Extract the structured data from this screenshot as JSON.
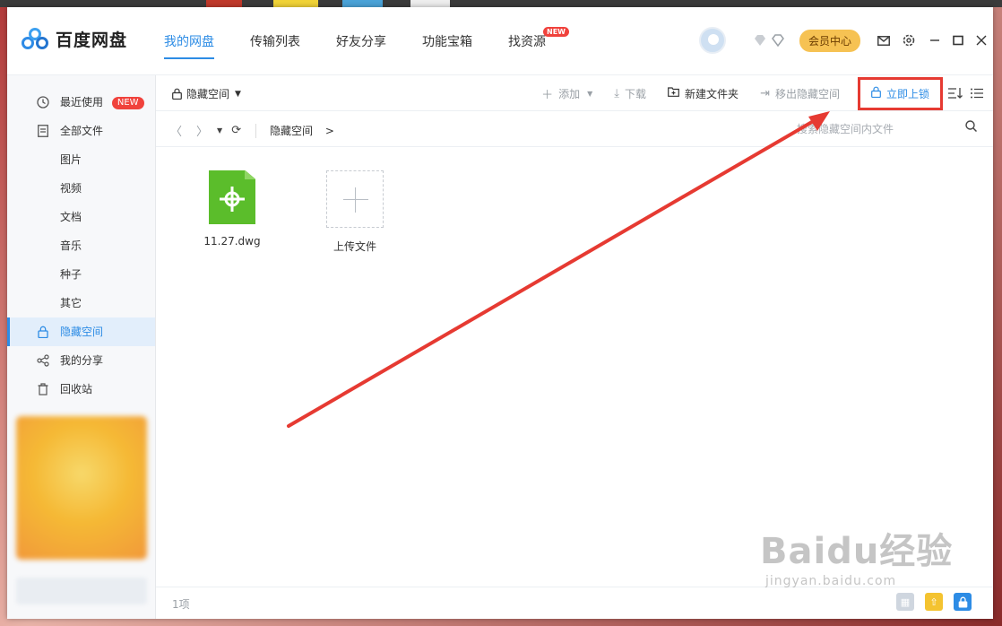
{
  "app": {
    "name": "百度网盘"
  },
  "nav": {
    "items": [
      {
        "label": "我的网盘",
        "active": true
      },
      {
        "label": "传输列表"
      },
      {
        "label": "好友分享"
      },
      {
        "label": "功能宝箱"
      },
      {
        "label": "找资源",
        "badge": "NEW"
      }
    ]
  },
  "header": {
    "vip_label": "会员中心"
  },
  "sidebar": {
    "items": [
      {
        "label": "最近使用",
        "icon": "clock-icon",
        "badge": "NEW"
      },
      {
        "label": "全部文件",
        "icon": "document-icon"
      },
      {
        "label": "图片",
        "sub": true
      },
      {
        "label": "视频",
        "sub": true
      },
      {
        "label": "文档",
        "sub": true
      },
      {
        "label": "音乐",
        "sub": true
      },
      {
        "label": "种子",
        "sub": true
      },
      {
        "label": "其它",
        "sub": true
      },
      {
        "label": "隐藏空间",
        "icon": "lock-icon",
        "active": true
      },
      {
        "label": "我的分享",
        "icon": "share-icon"
      },
      {
        "label": "回收站",
        "icon": "trash-icon"
      }
    ]
  },
  "toolbar": {
    "space_label": "隐藏空间",
    "add_label": "添加",
    "download_label": "下载",
    "new_folder_label": "新建文件夹",
    "move_out_label": "移出隐藏空间",
    "lock_now_label": "立即上锁"
  },
  "breadcrumb": {
    "path": "隐藏空间",
    "arrow": ">"
  },
  "search": {
    "placeholder": "搜索隐藏空间内文件"
  },
  "files": [
    {
      "name": "11.27.dwg",
      "type": "dwg",
      "icon": "dwg-file-icon"
    },
    {
      "name": "上传文件",
      "type": "upload",
      "icon": "plus-icon"
    }
  ],
  "status": {
    "count": "1项"
  },
  "watermark": {
    "logo": "Baidu经验",
    "url": "jingyan.baidu.com"
  },
  "colors": {
    "accent": "#2d8ce5",
    "annotation": "#e63a32",
    "dwg": "#5bbd2b",
    "vip": "#f6c253"
  }
}
